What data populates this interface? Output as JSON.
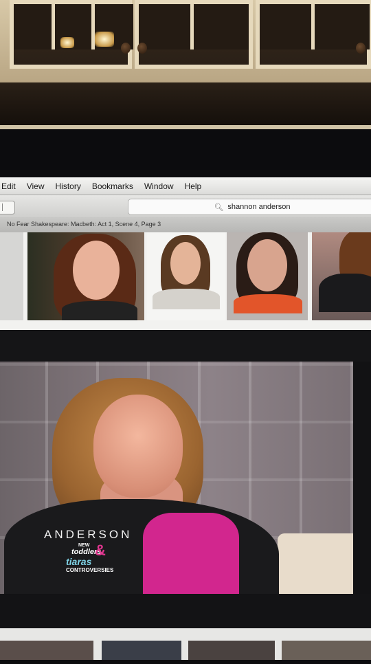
{
  "menubar": {
    "items": [
      "Edit",
      "View",
      "History",
      "Bookmarks",
      "Window",
      "Help"
    ]
  },
  "toolbar": {
    "search_value": "shannon anderson"
  },
  "tab": {
    "title": "No Fear Shakespeare: Macbeth: Act 1, Scene 4, Page 3"
  },
  "video": {
    "logo_word": "ANDERSON",
    "logo_new": "NEW",
    "logo_toddlers": "toddlers",
    "logo_tiaras": "tiaras",
    "logo_amp": "&",
    "logo_controversies": "CONTROVERSIES"
  },
  "colors": {
    "shirt": "#d2268e",
    "tiaras_text": "#7fd3e6",
    "ampersand": "#e0368f"
  }
}
